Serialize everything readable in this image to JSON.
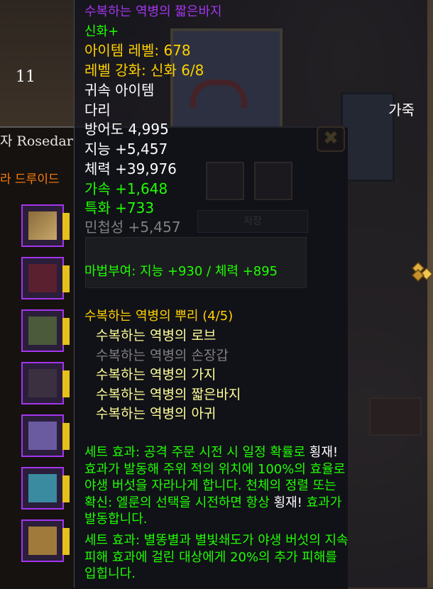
{
  "background": {
    "char_name": "자 Rosedar",
    "char_class": "라 드루이드",
    "close_glyph": "✖",
    "slot_count": "11",
    "tab_label": "저장"
  },
  "tooltip": {
    "item_name": "수복하는 역병의 짧은바지",
    "quality_track": "신화+",
    "item_level": "아이템 레벨: 678",
    "upgrade_level": "레벨 강화: 신화 6/8",
    "binding": "귀속 아이템",
    "slot": "다리",
    "armor_type": "가죽",
    "armor": "방어도 4,995",
    "stat_int": "지능 +5,457",
    "stat_sta": "체력 +39,976",
    "stat_haste": "가속 +1,648",
    "stat_mastery": "특화 +733",
    "stat_agi": "민첩성 +5,457",
    "enchant": "마법부여: 지능 +930 / 체력 +895",
    "gem_icon": "crafting-quality-icon",
    "set_name": "수복하는 역병의 뿌리 (4/5)",
    "set_items": [
      {
        "name": "수복하는 역병의 로브",
        "owned": true
      },
      {
        "name": "수복하는 역병의 손장갑",
        "owned": false
      },
      {
        "name": "수복하는 역병의 가지",
        "owned": true
      },
      {
        "name": "수복하는 역병의 짧은바지",
        "owned": true
      },
      {
        "name": "수복하는 역병의 아귀",
        "owned": true
      }
    ],
    "set_bonus_1": {
      "p1": "세트 효과: 공격 주문 시전 시 일정 확률로 ",
      "w1": "횡재!",
      "p2": "효과가 발동해 주위 적의 위치에 100%의 효율로",
      "p3": "야생 버섯을 자라나게 합니다. 천체의 정렬 또는",
      "p4": "확신: 엘룬의 선택을 시전하면 항상 ",
      "w2": "횡재!",
      "p5": " 효과가",
      "p6": "발동합니다."
    },
    "set_bonus_2": {
      "l1": "세트 효과: 별똥별과 별빛쇄도가 야생 버섯의 지속",
      "l2": "피해 효과에 걸린 대상에게 20%의 추가 피해를",
      "l3": "입힙니다."
    }
  },
  "colors": {
    "epic": "#a335ee",
    "gold": "#ffd100",
    "uncommon": "#1eff00",
    "disabled": "#808080"
  }
}
